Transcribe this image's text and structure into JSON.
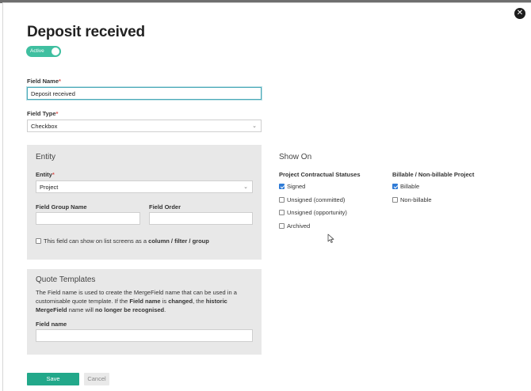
{
  "header": {
    "title": "Deposit received",
    "toggle_label": "Active"
  },
  "field_name": {
    "label": "Field Name",
    "required_mark": "*",
    "value": "Deposit received"
  },
  "field_type": {
    "label": "Field Type",
    "required_mark": "*",
    "value": "Checkbox"
  },
  "entity_panel": {
    "title": "Entity",
    "entity_label": "Entity",
    "required_mark": "*",
    "entity_value": "Project",
    "group_name_label": "Field Group Name",
    "group_name_value": "",
    "order_label": "Field Order",
    "order_value": "",
    "list_screens_text": "This field can show on list screens as a",
    "list_screens_bold": "column / filter / group",
    "list_screens_checked": false
  },
  "show_on": {
    "title": "Show On",
    "statuses_header": "Project Contractual Statuses",
    "statuses": [
      {
        "label": "Signed",
        "checked": true
      },
      {
        "label": "Unsigned (committed)",
        "checked": false
      },
      {
        "label": "Unsigned (opportunity)",
        "checked": false
      },
      {
        "label": "Archived",
        "checked": false
      }
    ],
    "billable_header": "Billable / Non-billable Project",
    "billable": [
      {
        "label": "Billable",
        "checked": true
      },
      {
        "label": "Non-billable",
        "checked": false
      }
    ]
  },
  "quote_panel": {
    "title": "Quote Templates",
    "p1": "The Field name is used to create the MergeField name that can be used in a",
    "p2_a": "customisable quote template. If the",
    "p2_b": "Field name",
    "p2_c": "is",
    "p2_d": "changed",
    "p2_e": ", the",
    "p2_f": "historic",
    "p3_a": "MergeField",
    "p3_b": "name will",
    "p3_c": "no longer be recognised",
    "p3_d": ".",
    "field_label": "Field name",
    "field_value": ""
  },
  "actions": {
    "save_label": "Save",
    "cancel_label": "Cancel"
  },
  "colors": {
    "accent": "#22a88a",
    "toggle": "#3fbfa0",
    "checkbox_checked": "#2f7bd6",
    "panel_bg": "#e8e8e8"
  }
}
